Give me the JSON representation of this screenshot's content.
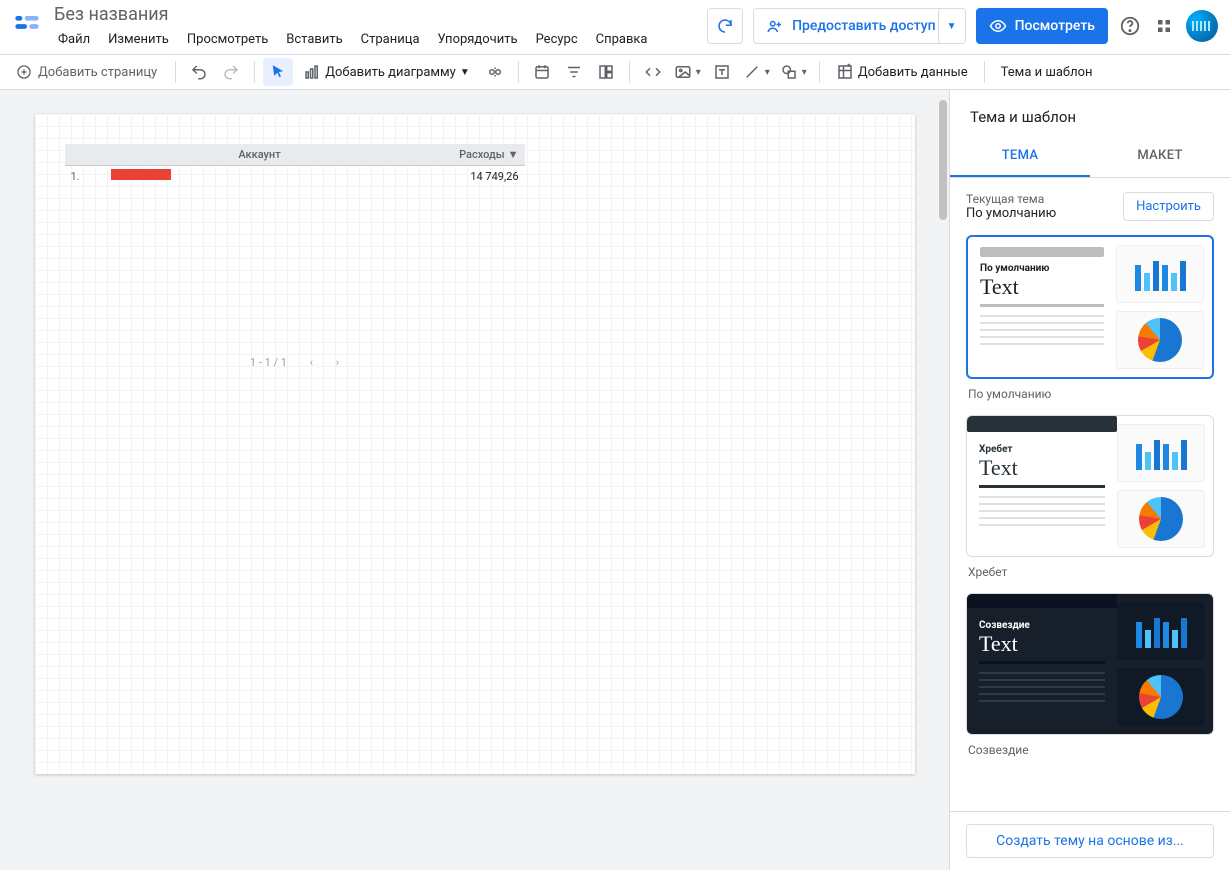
{
  "header": {
    "doc_title": "Без названия",
    "menu": [
      "Файл",
      "Изменить",
      "Просмотреть",
      "Вставить",
      "Страница",
      "Упорядочить",
      "Ресурс",
      "Справка"
    ],
    "refresh_tooltip": "Обновить",
    "share_label": "Предоставить доступ",
    "view_label": "Посмотреть"
  },
  "toolbar": {
    "add_page": "Добавить страницу",
    "add_chart": "Добавить диаграмму",
    "add_data": "Добавить данные",
    "theme_layout": "Тема и шаблон"
  },
  "table": {
    "col_account": "Аккаунт",
    "col_spend": "Расходы",
    "rows": [
      {
        "idx": "1.",
        "value": "14 749,26"
      }
    ],
    "pager": "1 - 1 / 1"
  },
  "panel": {
    "title": "Тема и шаблон",
    "tab_theme": "ТЕМА",
    "tab_layout": "МАКЕТ",
    "current_label": "Текущая тема",
    "current_value": "По умолчанию",
    "customize": "Настроить",
    "themes": [
      {
        "name": "По умолчанию",
        "preview_title": "По умолчанию"
      },
      {
        "name": "Хребет",
        "preview_title": "Хребет"
      },
      {
        "name": "Созвездие",
        "preview_title": "Созвездие"
      }
    ],
    "create_theme": "Создать тему на основе из..."
  }
}
